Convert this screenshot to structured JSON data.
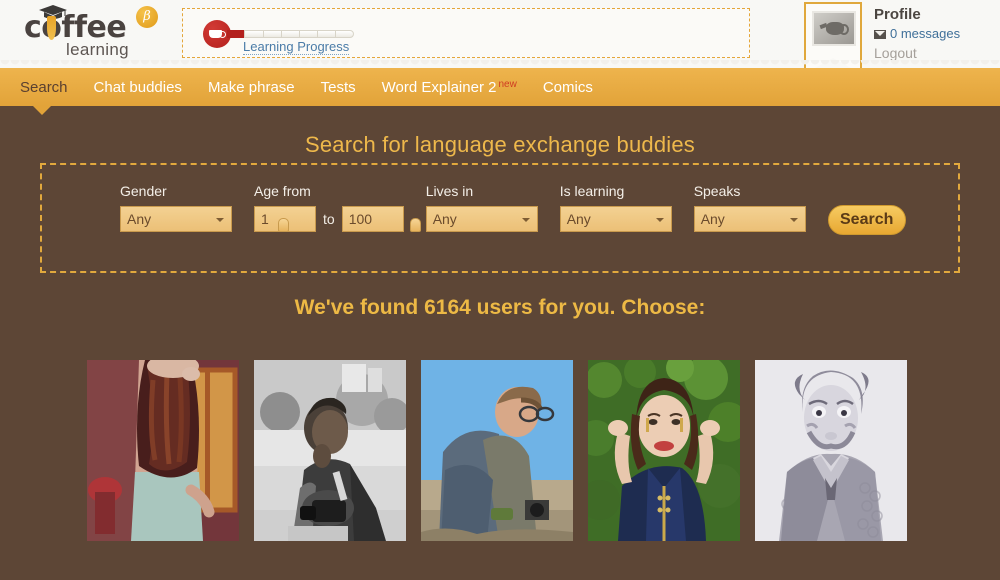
{
  "header": {
    "logo": {
      "word": "coffee",
      "sub": "learning",
      "beta": "β",
      "cap_icon": "graduation-cap-icon"
    },
    "progress": {
      "link_label": "Learning Progress",
      "bulb_icon": "coffee-cup-icon",
      "ticks": 6
    },
    "profile": {
      "name": "Profile",
      "messages": "0 messages",
      "messages_icon": "envelope-icon",
      "logout": "Logout",
      "avatar_icon": "teapot-photo-icon"
    }
  },
  "nav": {
    "items": [
      {
        "label": "Search",
        "active": true,
        "badge": ""
      },
      {
        "label": "Chat buddies",
        "active": false,
        "badge": ""
      },
      {
        "label": "Make phrase",
        "active": false,
        "badge": ""
      },
      {
        "label": "Tests",
        "active": false,
        "badge": ""
      },
      {
        "label": "Word Explainer 2",
        "active": false,
        "badge": "new"
      },
      {
        "label": "Comics",
        "active": false,
        "badge": ""
      }
    ]
  },
  "main": {
    "page_title": "Search for language exchange buddies",
    "results_title": "We've found 6164 users for you. Choose:",
    "results_count": 6164,
    "search_form": {
      "gender": {
        "label": "Gender",
        "value": "Any"
      },
      "age": {
        "label": "Age from",
        "from": "1",
        "to_word": "to",
        "to": "100"
      },
      "lives_in": {
        "label": "Lives in",
        "value": "Any"
      },
      "is_learning": {
        "label": "Is learning",
        "value": "Any"
      },
      "speaks": {
        "label": "Speaks",
        "value": "Any"
      },
      "search_button": "Search"
    },
    "photos": [
      {
        "alt": "woman with long wavy auburn hair seen from behind by a window"
      },
      {
        "alt": "black and white photo of a smiling man holding a camera"
      },
      {
        "alt": "man in glasses sitting outdoors against a blue sky"
      },
      {
        "alt": "smiling woman in a blue zip top with hands behind her head, green foliage"
      },
      {
        "alt": "black and white stylized portrait of a man in a suit with face paint"
      }
    ]
  },
  "colors": {
    "page_background": "#5d4636",
    "nav_background": "#e2a339",
    "header_background": "#f2f0eb",
    "accent_gold": "#edb945",
    "link_blue": "#3f7099",
    "field_fill": "#ecc077",
    "new_badge_red": "#cf3b22"
  }
}
